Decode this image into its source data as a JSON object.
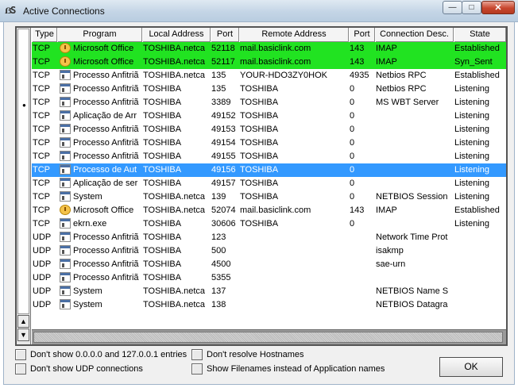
{
  "window": {
    "title": "Active Connections",
    "icon_name": "app-logo-icon"
  },
  "controls": {
    "minimize": "—",
    "maximize": "□",
    "close": "✕"
  },
  "columns": [
    "Type",
    "Program",
    "Local Address",
    "Port",
    "Remote Address",
    "Port",
    "Connection Desc.",
    "State"
  ],
  "rows": [
    {
      "type": "TCP",
      "icon": "clock-icon",
      "program": "Microsoft Office",
      "local": "TOSHIBA.netca",
      "lport": "52118",
      "remote": "mail.basiclink.com",
      "rport": "143",
      "desc": "IMAP",
      "state": "Established",
      "highlight": "green"
    },
    {
      "type": "TCP",
      "icon": "clock-icon",
      "program": "Microsoft Office",
      "local": "TOSHIBA.netca",
      "lport": "52117",
      "remote": "mail.basiclink.com",
      "rport": "143",
      "desc": "IMAP",
      "state": "Syn_Sent",
      "highlight": "green"
    },
    {
      "type": "TCP",
      "icon": "exe-icon",
      "program": "Processo Anfitriã",
      "local": "TOSHIBA.netca",
      "lport": "135",
      "remote": "YOUR-HDO3ZY0HOK",
      "rport": "4935",
      "desc": "Netbios RPC",
      "state": "Established",
      "highlight": ""
    },
    {
      "type": "TCP",
      "icon": "exe-icon",
      "program": "Processo Anfitriã",
      "local": "TOSHIBA",
      "lport": "135",
      "remote": "TOSHIBA",
      "rport": "0",
      "desc": "Netbios RPC",
      "state": "Listening",
      "highlight": ""
    },
    {
      "type": "TCP",
      "icon": "exe-icon",
      "program": "Processo Anfitriã",
      "local": "TOSHIBA",
      "lport": "3389",
      "remote": "TOSHIBA",
      "rport": "0",
      "desc": "MS WBT Server",
      "state": "Listening",
      "highlight": ""
    },
    {
      "type": "TCP",
      "icon": "exe-icon",
      "program": "Aplicação de Arr",
      "local": "TOSHIBA",
      "lport": "49152",
      "remote": "TOSHIBA",
      "rport": "0",
      "desc": "",
      "state": "Listening",
      "highlight": ""
    },
    {
      "type": "TCP",
      "icon": "exe-icon",
      "program": "Processo Anfitriã",
      "local": "TOSHIBA",
      "lport": "49153",
      "remote": "TOSHIBA",
      "rport": "0",
      "desc": "",
      "state": "Listening",
      "highlight": ""
    },
    {
      "type": "TCP",
      "icon": "exe-icon",
      "program": "Processo Anfitriã",
      "local": "TOSHIBA",
      "lport": "49154",
      "remote": "TOSHIBA",
      "rport": "0",
      "desc": "",
      "state": "Listening",
      "highlight": ""
    },
    {
      "type": "TCP",
      "icon": "exe-icon",
      "program": "Processo Anfitriã",
      "local": "TOSHIBA",
      "lport": "49155",
      "remote": "TOSHIBA",
      "rport": "0",
      "desc": "",
      "state": "Listening",
      "highlight": ""
    },
    {
      "type": "TCP",
      "icon": "exe-icon",
      "program": "Processo de Aut",
      "local": "TOSHIBA",
      "lport": "49156",
      "remote": "TOSHIBA",
      "rport": "0",
      "desc": "",
      "state": "Listening",
      "highlight": "blue"
    },
    {
      "type": "TCP",
      "icon": "exe-icon",
      "program": "Aplicação de ser",
      "local": "TOSHIBA",
      "lport": "49157",
      "remote": "TOSHIBA",
      "rport": "0",
      "desc": "",
      "state": "Listening",
      "highlight": ""
    },
    {
      "type": "TCP",
      "icon": "exe-icon",
      "program": "System",
      "local": "TOSHIBA.netca",
      "lport": "139",
      "remote": "TOSHIBA",
      "rport": "0",
      "desc": "NETBIOS Session",
      "state": "Listening",
      "highlight": ""
    },
    {
      "type": "TCP",
      "icon": "clock-icon",
      "program": "Microsoft Office",
      "local": "TOSHIBA.netca",
      "lport": "52074",
      "remote": "mail.basiclink.com",
      "rport": "143",
      "desc": "IMAP",
      "state": "Established",
      "highlight": ""
    },
    {
      "type": "TCP",
      "icon": "exe-icon",
      "program": "ekrn.exe",
      "local": "TOSHIBA",
      "lport": "30606",
      "remote": "TOSHIBA",
      "rport": "0",
      "desc": "",
      "state": "Listening",
      "highlight": ""
    },
    {
      "type": "UDP",
      "icon": "exe-icon",
      "program": "Processo Anfitriã",
      "local": "TOSHIBA",
      "lport": "123",
      "remote": "",
      "rport": "",
      "desc": "Network Time Prot",
      "state": "",
      "highlight": ""
    },
    {
      "type": "UDP",
      "icon": "exe-icon",
      "program": "Processo Anfitriã",
      "local": "TOSHIBA",
      "lport": "500",
      "remote": "",
      "rport": "",
      "desc": "isakmp",
      "state": "",
      "highlight": ""
    },
    {
      "type": "UDP",
      "icon": "exe-icon",
      "program": "Processo Anfitriã",
      "local": "TOSHIBA",
      "lport": "4500",
      "remote": "",
      "rport": "",
      "desc": "sae-urn",
      "state": "",
      "highlight": ""
    },
    {
      "type": "UDP",
      "icon": "exe-icon",
      "program": "Processo Anfitriã",
      "local": "TOSHIBA",
      "lport": "5355",
      "remote": "",
      "rport": "",
      "desc": "",
      "state": "",
      "highlight": ""
    },
    {
      "type": "UDP",
      "icon": "exe-icon",
      "program": "System",
      "local": "TOSHIBA.netca",
      "lport": "137",
      "remote": "",
      "rport": "",
      "desc": "NETBIOS Name S",
      "state": "",
      "highlight": ""
    },
    {
      "type": "UDP",
      "icon": "exe-icon",
      "program": "System",
      "local": "TOSHIBA.netca",
      "lport": "138",
      "remote": "",
      "rport": "",
      "desc": "NETBIOS Datagra",
      "state": "",
      "highlight": ""
    }
  ],
  "options": {
    "hide_local": "Don't show 0.0.0.0 and 127.0.0.1 entries",
    "hide_udp": "Don't show UDP connections",
    "no_resolve": "Don't resolve Hostnames",
    "show_filenames": "Show Filenames instead of Application names"
  },
  "ok_label": "OK",
  "scroll": {
    "up": "▲",
    "down": "▼",
    "thumb_mark": "●"
  },
  "colors": {
    "highlight_green": "#21e321",
    "highlight_blue": "#3399ff"
  }
}
